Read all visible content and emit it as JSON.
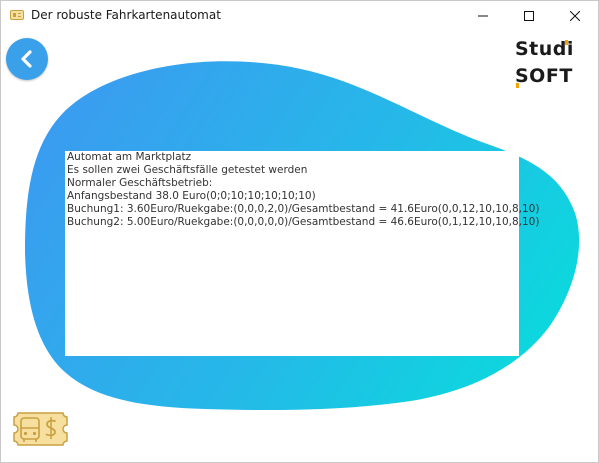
{
  "window": {
    "title": "Der robuste Fahrkartenautomat",
    "icon": "ticket-app-icon",
    "controls": [
      "minimize-icon",
      "maximize-icon",
      "close-icon"
    ]
  },
  "navigation": {
    "back_icon": "chevron-left-icon"
  },
  "logo": {
    "line1": "Studi",
    "line2": "SOFT",
    "accent_color": "#f5a300"
  },
  "output": {
    "lines": [
      "Automat am Marktplatz",
      "Es sollen zwei Geschäftsfälle getestet werden",
      "Normaler Geschäftsbetrieb:",
      "Anfangsbestand 38.0 Euro(0;0;10;10;10;10;10)",
      "Buchung1: 3.60Euro/Ruekgabe:(0,0,0,2,0)/Gesamtbestand = 41.6Euro(0,0,12,10,10,8,10)",
      "Buchung2: 5.00Euro/Ruekgabe:(0,0,0,0,0)/Gesamtbestand = 46.6Euro(0,1,12,10,10,8,10)"
    ]
  },
  "ticket_button": {
    "icon": "ticket-bus-dollar-icon"
  },
  "colors": {
    "blob_gradient_start": "#3a9cf0",
    "blob_gradient_end": "#0bd9dd",
    "back_button": "#3aa0ea",
    "ticket_fill": "#f7dfa0",
    "ticket_stroke": "#c9a040"
  }
}
